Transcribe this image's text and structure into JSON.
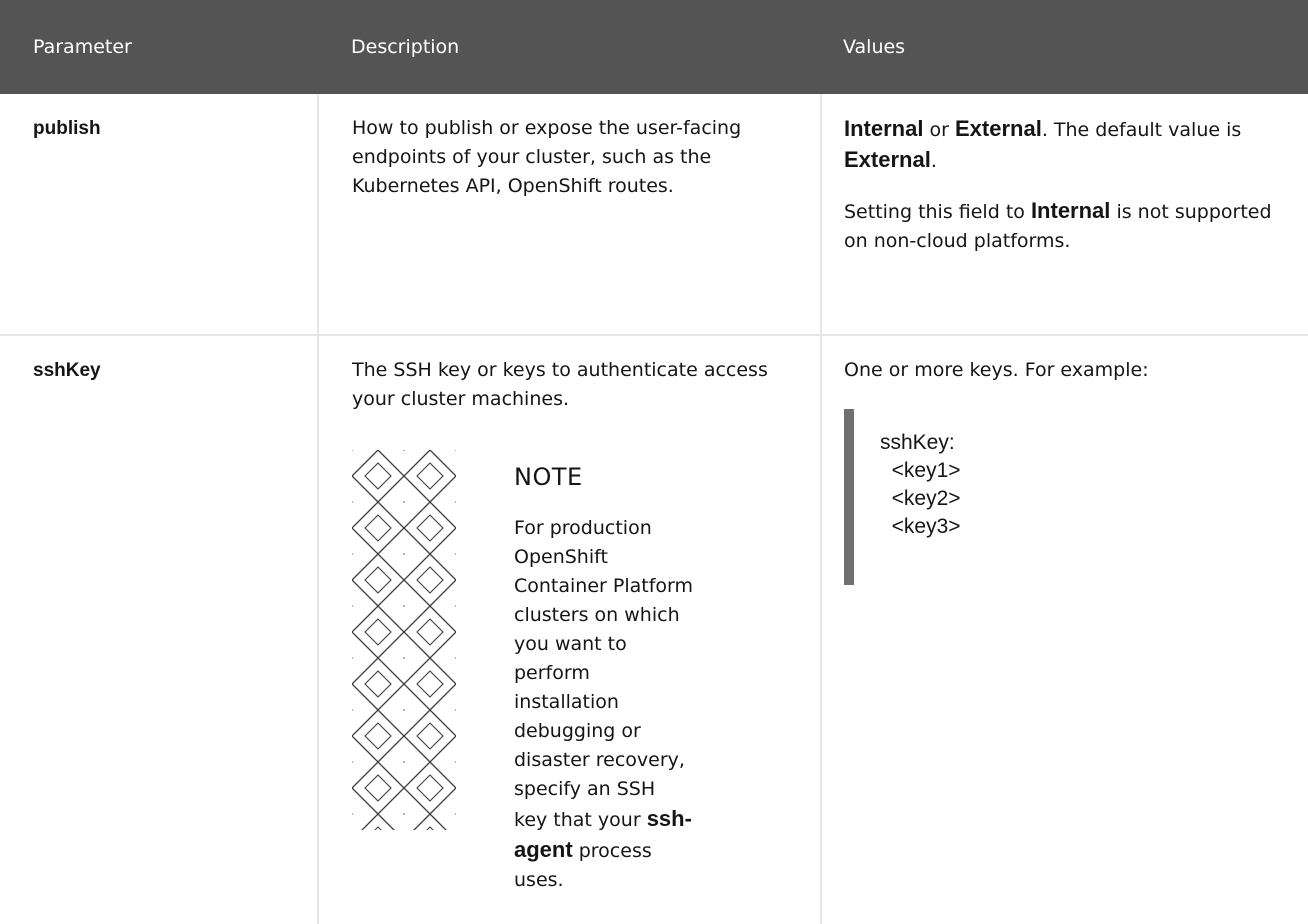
{
  "table": {
    "headers": [
      "Parameter",
      "Description",
      "Values"
    ]
  },
  "rows": {
    "publish": {
      "name": "publish",
      "description": "How to publish or expose the user-facing endpoints of your cluster, such as the Kubernetes API, OpenShift routes.",
      "values": {
        "internal": "Internal",
        "or": " or ",
        "external": "External",
        "default_text": ". The default value is ",
        "default_value": "External",
        "period": ".",
        "setting_prefix": "Setting this field to ",
        "setting_value": "Internal",
        "setting_suffix": " is not supported on non-cloud platforms."
      }
    },
    "sshKey": {
      "name": "sshKey",
      "description": "The SSH key or keys to authenticate access your cluster machines.",
      "note": {
        "title": "NOTE",
        "text_before": "For production OpenShift Container Platform clusters on which you want to perform installation debugging or disaster recovery, specify an SSH key that your ",
        "agent": "ssh-agent",
        "text_after": " process uses."
      },
      "values": {
        "intro": "One or more keys. For example:",
        "code": "sshKey:\n  <key1>\n  <key2>\n  <key3>"
      }
    }
  },
  "colors": {
    "header_bg": "#545454",
    "header_text": "#ffffff",
    "border": "#e6e6e6",
    "code_bar": "#707070"
  },
  "icons": {
    "note": "diamond-lattice-pattern-icon"
  }
}
